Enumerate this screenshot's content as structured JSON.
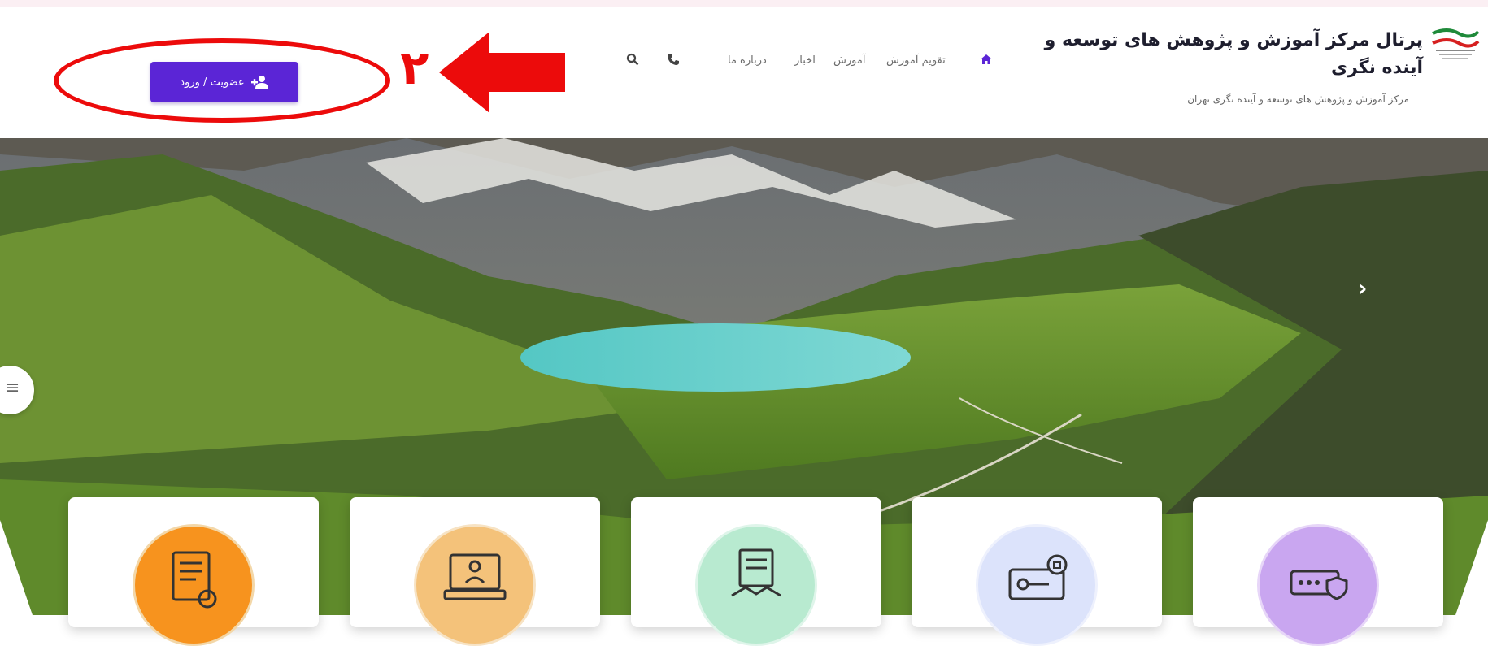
{
  "header": {
    "title": "پرتال مرکز آموزش و پژوهش های توسعه و آینده نگری",
    "subtitle": "مرکز آموزش و پژوهش های توسعه و آینده نگری تهران",
    "logo_icon": "organization-logo-icon"
  },
  "nav": {
    "items": [
      {
        "label": "تقویم آموزش",
        "name": "nav-calendar"
      },
      {
        "label": "آموزش",
        "name": "nav-education"
      },
      {
        "label": "اخبار",
        "name": "nav-news"
      },
      {
        "label": "درباره ما",
        "name": "nav-about"
      }
    ],
    "icons": [
      "home-icon",
      "phone-icon",
      "search-icon"
    ]
  },
  "login": {
    "label": "عضویت / ورود",
    "icon": "user-plus-icon"
  },
  "annotation": {
    "number": "۲",
    "color": "#ec0b0b"
  },
  "colors": {
    "accent": "#5b25d6",
    "annotation": "#ec0b0b"
  },
  "cards": [
    {
      "icon": "document-key-icon",
      "color": "#f7931e"
    },
    {
      "icon": "laptop-user-icon",
      "color": "#f4c27a"
    },
    {
      "icon": "contract-handshake-icon",
      "color": "#b8ead0"
    },
    {
      "icon": "password-key-icon",
      "color": "#dce3fb"
    },
    {
      "icon": "password-shield-icon",
      "color": "#c9a6f0"
    }
  ]
}
